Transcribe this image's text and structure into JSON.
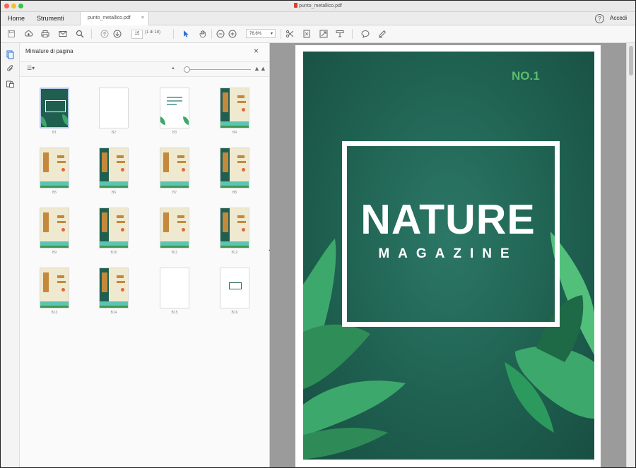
{
  "window": {
    "title": "punto_metallico.pdf"
  },
  "tabs": {
    "home": "Home",
    "tools": "Strumenti",
    "document": "punto_metallico.pdf",
    "close": "×"
  },
  "header_right": {
    "help_symbol": "?",
    "login": "Accedi"
  },
  "toolbar": {
    "page_current": "15",
    "page_count": "(1 di 18)",
    "zoom": "76,6%",
    "icons": [
      "save-icon",
      "cloud-upload-icon",
      "print-icon",
      "mail-icon",
      "search-icon",
      "page-up-icon",
      "page-down-icon",
      "select-arrow-icon",
      "hand-icon",
      "zoom-out-icon",
      "zoom-in-icon",
      "crop-icon",
      "fit-page-icon",
      "fullscreen-icon",
      "stamp-icon",
      "comment-icon",
      "pen-icon"
    ]
  },
  "rail": {
    "icons": [
      "pages-icon",
      "attachment-icon",
      "lock-icon"
    ]
  },
  "thumbnails_panel": {
    "title": "Miniature di pagina",
    "close": "×",
    "options": "☰▾",
    "pages": [
      {
        "label": "B1",
        "kind": "cover",
        "selected": true
      },
      {
        "label": "B2",
        "kind": "blank"
      },
      {
        "label": "B3",
        "kind": "green"
      },
      {
        "label": "B4",
        "kind": "spread-dark"
      },
      {
        "label": "B5",
        "kind": "spread"
      },
      {
        "label": "B6",
        "kind": "spread-dark"
      },
      {
        "label": "B7",
        "kind": "spread"
      },
      {
        "label": "B8",
        "kind": "spread-dark"
      },
      {
        "label": "B9",
        "kind": "spread"
      },
      {
        "label": "B10",
        "kind": "spread-dark"
      },
      {
        "label": "B11",
        "kind": "spread"
      },
      {
        "label": "B12",
        "kind": "spread-dark"
      },
      {
        "label": "B13",
        "kind": "spread"
      },
      {
        "label": "B14",
        "kind": "spread-dark"
      },
      {
        "label": "B15",
        "kind": "blank"
      },
      {
        "label": "B16",
        "kind": "white-bar"
      }
    ]
  },
  "document": {
    "issue": "NO.1",
    "title": "NATURE",
    "subtitle": "MAGAZINE",
    "colors": {
      "background": "#1f6151",
      "accent": "#5dbb6c",
      "leaf": "#3da86b"
    }
  }
}
